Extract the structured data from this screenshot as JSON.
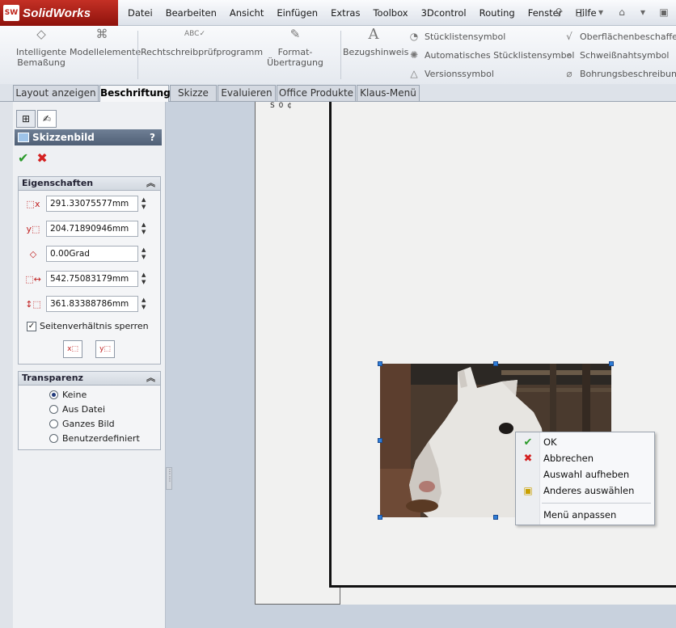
{
  "app": {
    "logo_badge": "SW",
    "name": "SolidWorks"
  },
  "menu": [
    "Datei",
    "Bearbeiten",
    "Ansicht",
    "Einfügen",
    "Extras",
    "Toolbox",
    "3Dcontrol",
    "Routing",
    "Fenster",
    "Hilfe"
  ],
  "toolbar_big": [
    {
      "label1": "Intelligente",
      "label2": "Bemaßung",
      "icon": "smart-dimension-icon"
    },
    {
      "label1": "Modellelemente",
      "label2": "",
      "icon": "model-items-icon"
    },
    {
      "label1": "Rechtschreibprüfprogramm",
      "label2": "",
      "icon": "spell-check-icon"
    },
    {
      "label1": "Format-Übertragung",
      "label2": "",
      "icon": "format-painter-icon"
    },
    {
      "label1": "Bezugshinweis",
      "label2": "",
      "icon": "note-icon"
    }
  ],
  "toolbar_small": [
    {
      "label": "Stücklistensymbol"
    },
    {
      "label": "Automatisches Stücklistensymbol"
    },
    {
      "label": "Versionssymbol"
    },
    {
      "label": "Oberflächenbeschaffenheit"
    },
    {
      "label": "Schweißnahtsymbol"
    },
    {
      "label": "Bohrungsbeschreibung"
    }
  ],
  "tabs": [
    "Layout anzeigen",
    "Beschriftung",
    "Skizze",
    "Evaluieren",
    "Office Produkte",
    "Klaus-Menü"
  ],
  "active_tab": "Beschriftung",
  "panel": {
    "title": "Skizzenbild",
    "help": "?",
    "eigenschaften": {
      "header": "Eigenschaften",
      "values": [
        "291.33075577mm",
        "204.71890946mm",
        "0.00Grad",
        "542.75083179mm",
        "361.83388786mm"
      ],
      "lock_aspect": "Seitenverhältnis sperren",
      "lock_checked": true
    },
    "transparenz": {
      "header": "Transparenz",
      "options": [
        "Keine",
        "Aus Datei",
        "Ganzes Bild",
        "Benutzerdefiniert"
      ],
      "selected": "Keine"
    }
  },
  "context_menu": [
    {
      "label": "OK",
      "icon": "check-icon",
      "color": "#2a9a2a"
    },
    {
      "label": "Abbrechen",
      "icon": "cross-icon",
      "color": "#d42020"
    },
    {
      "label": "Auswahl aufheben",
      "icon": "",
      "color": ""
    },
    {
      "label": "Anderes auswählen",
      "icon": "select-other-icon",
      "color": "#c9a000"
    },
    {
      "label": "Menü anpassen",
      "icon": "",
      "color": ""
    }
  ],
  "sheet_text": "S 0 ¢"
}
